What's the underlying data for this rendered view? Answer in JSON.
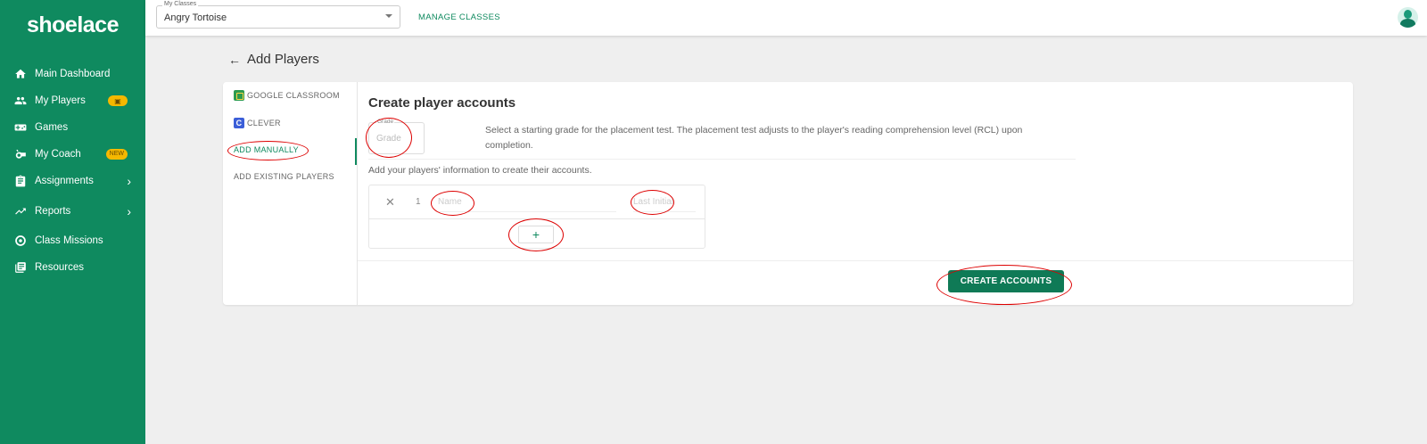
{
  "app": {
    "logo_text": "shoelace"
  },
  "sidebar": {
    "items": [
      {
        "label": "Main Dashboard",
        "icon": "home-icon"
      },
      {
        "label": "My Players",
        "icon": "people-icon",
        "badge": "gift-icon"
      },
      {
        "label": "Games",
        "icon": "gamepad-icon"
      },
      {
        "label": "My Coach",
        "icon": "whistle-icon",
        "badge": "NEW"
      },
      {
        "label": "Assignments",
        "icon": "clipboard-icon",
        "chevron": true
      },
      {
        "label": "Reports",
        "icon": "trending-up-icon",
        "chevron": true
      },
      {
        "label": "Class Missions",
        "icon": "target-icon"
      },
      {
        "label": "Resources",
        "icon": "library-icon"
      }
    ]
  },
  "topbar": {
    "class_select_label": "My Classes",
    "class_select_value": "Angry Tortoise",
    "manage_classes_label": "MANAGE CLASSES"
  },
  "page": {
    "title": "Add Players"
  },
  "tabs": [
    {
      "label": "GOOGLE CLASSROOM"
    },
    {
      "label": "CLEVER"
    },
    {
      "label": "ADD MANUALLY"
    },
    {
      "label": "ADD EXISTING PLAYERS"
    }
  ],
  "form": {
    "title": "Create player accounts",
    "grade_label": "Grade",
    "grade_placeholder": "Grade",
    "grade_help": "Select a starting grade for the placement test. The placement test adjusts to the player's reading comprehension level (RCL) upon completion.",
    "players_help": "Add your players' information to create their accounts.",
    "rows": [
      {
        "index": "1",
        "name_placeholder": "Name",
        "initial_placeholder": "Last Initial"
      }
    ],
    "add_row_label": "+",
    "remove_label": "✕",
    "submit_label": "CREATE ACCOUNTS"
  },
  "colors": {
    "brand": "#0f8a5f",
    "annotation": "#dd0000"
  }
}
